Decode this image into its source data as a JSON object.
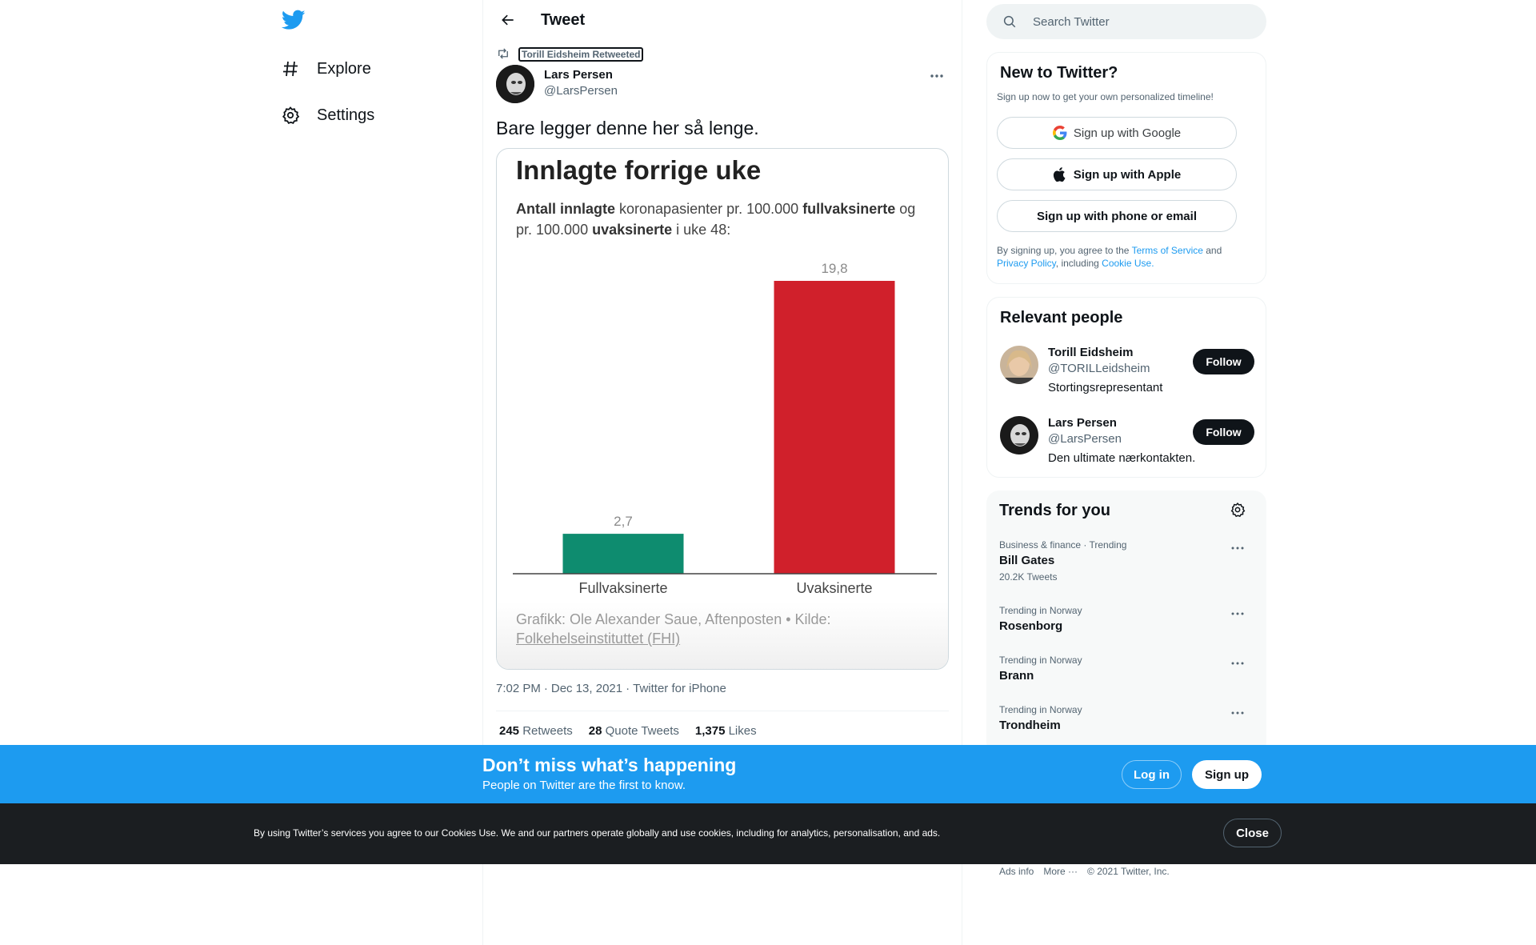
{
  "nav": {
    "items": [
      {
        "label": "Explore",
        "icon": "hashtag-icon"
      },
      {
        "label": "Settings",
        "icon": "gear-icon"
      }
    ]
  },
  "header": {
    "title": "Tweet"
  },
  "tweet": {
    "retweeted_by": "Torill Eidsheim Retweeted",
    "author_name": "Lars Persen",
    "author_handle": "@LarsPersen",
    "text": "Bare legger denne her så lenge.",
    "time": "7:02 PM",
    "date": "Dec 13, 2021",
    "source": "Twitter for iPhone",
    "retweets_count": "245",
    "retweets_label": "Retweets",
    "quotes_count": "28",
    "quotes_label": "Quote Tweets",
    "likes_count": "1,375",
    "likes_label": "Likes",
    "media": {
      "subtitle_parts": {
        "p1": "Antall innlagte",
        "p2": " koronapasienter pr. 100.000 ",
        "p3": "fullvaksinerte",
        "p4": " og pr. 100.000 ",
        "p5": "uvaksinerte",
        "p6": " i uke 48:"
      },
      "source_text": "Grafikk: Ole Alexander Saue, Aftenposten • Kilde: ",
      "source_link": "Folkehelseinstituttet (FHI)"
    }
  },
  "chart_data": {
    "type": "bar",
    "title": "Innlagte forrige uke",
    "categories": [
      "Fullvaksinerte",
      "Uvaksinerte"
    ],
    "values": [
      2.7,
      19.8
    ],
    "value_labels": [
      "2,7",
      "19,8"
    ],
    "colors": [
      "#0e8c6f",
      "#d0202b"
    ],
    "ylim": [
      0,
      19.8
    ],
    "grid": false
  },
  "search": {
    "placeholder": "Search Twitter"
  },
  "new_to_twitter": {
    "title": "New to Twitter?",
    "subtitle": "Sign up now to get your own personalized timeline!",
    "google": "Sign up with Google",
    "apple": "Sign up with Apple",
    "phone": "Sign up with phone or email",
    "terms_1": "By signing up, you agree to the ",
    "terms_link_1": "Terms of Service",
    "terms_2": " and ",
    "terms_link_2": "Privacy Policy",
    "terms_3": ", including ",
    "terms_link_3": "Cookie Use."
  },
  "relevant_people": {
    "title": "Relevant people",
    "people": [
      {
        "name": "Torill Eidsheim",
        "handle": "@TORILLeidsheim",
        "bio": "Stortingsrepresentant",
        "follow": "Follow"
      },
      {
        "name": "Lars Persen",
        "handle": "@LarsPersen",
        "bio": "Den ultimate nærkontakten.",
        "follow": "Follow"
      }
    ]
  },
  "trends": {
    "title": "Trends for you",
    "items": [
      {
        "context": "Business & finance · Trending",
        "name": "Bill Gates",
        "count": "20.2K Tweets"
      },
      {
        "context": "Trending in Norway",
        "name": "Rosenborg",
        "count": ""
      },
      {
        "context": "Trending in Norway",
        "name": "Brann",
        "count": ""
      },
      {
        "context": "Trending in Norway",
        "name": "Trondheim",
        "count": ""
      }
    ]
  },
  "footer": {
    "ads": "Ads info",
    "more": "More ···",
    "copyright": "© 2021 Twitter, Inc."
  },
  "banner": {
    "title": "Don’t miss what’s happening",
    "subtitle": "People on Twitter are the first to know.",
    "login": "Log in",
    "signup": "Sign up"
  },
  "cookie": {
    "text": "By using Twitter’s services you agree to our Cookies Use. We and our partners operate globally and use cookies, including for analytics, personalisation, and ads.",
    "close": "Close"
  },
  "colors": {
    "accent": "#1d9bf0",
    "text": "#0f1419",
    "muted": "#536471"
  }
}
